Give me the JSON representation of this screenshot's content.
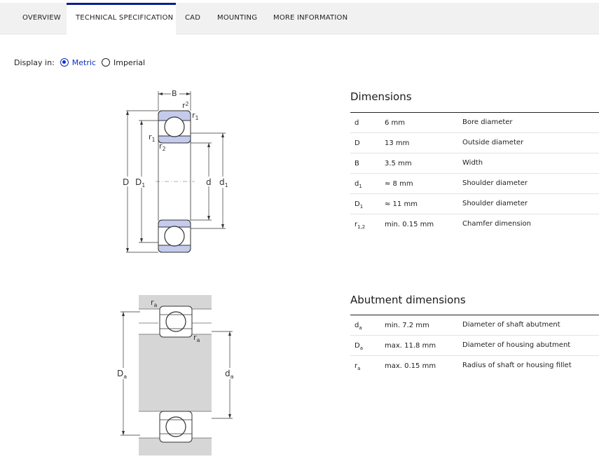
{
  "tabs": [
    {
      "label": "OVERVIEW",
      "active": false
    },
    {
      "label": "TECHNICAL SPECIFICATION",
      "active": true
    },
    {
      "label": "CAD",
      "active": false
    },
    {
      "label": "MOUNTING",
      "active": false
    },
    {
      "label": "MORE INFORMATION",
      "active": false
    }
  ],
  "display": {
    "label": "Display in:",
    "options": [
      {
        "label": "Metric",
        "selected": true
      },
      {
        "label": "Imperial",
        "selected": false
      }
    ]
  },
  "dimensions": {
    "title": "Dimensions",
    "rows": [
      {
        "sym": "d",
        "sub": "",
        "value": "6 mm",
        "desc": "Bore diameter"
      },
      {
        "sym": "D",
        "sub": "",
        "value": "13 mm",
        "desc": "Outside diameter"
      },
      {
        "sym": "B",
        "sub": "",
        "value": "3.5 mm",
        "desc": "Width"
      },
      {
        "sym": "d",
        "sub": "1",
        "value": "≈ 8 mm",
        "desc": "Shoulder diameter"
      },
      {
        "sym": "D",
        "sub": "1",
        "value": "≈ 11 mm",
        "desc": "Shoulder diameter"
      },
      {
        "sym": "r",
        "sub": "1,2",
        "value": "min. 0.15 mm",
        "desc": "Chamfer dimension"
      }
    ]
  },
  "abutment": {
    "title": "Abutment dimensions",
    "rows": [
      {
        "sym": "d",
        "sub": "a",
        "value": "min. 7.2 mm",
        "desc": "Diameter of shaft abutment"
      },
      {
        "sym": "D",
        "sub": "a",
        "value": "max. 11.8 mm",
        "desc": "Diameter of housing abutment"
      },
      {
        "sym": "r",
        "sub": "a",
        "value": "max. 0.15 mm",
        "desc": "Radius of shaft or housing fillet"
      }
    ]
  },
  "diagram1_labels": {
    "B": "B",
    "r2_top": "r",
    "r2_top_sub": "2",
    "r1_top": "r",
    "r1_top_sub": "1",
    "r1_left": "r",
    "r1_left_sub": "1",
    "r2_left": "r",
    "r2_left_sub": "2",
    "D": "D",
    "D1": "D",
    "D1_sub": "1",
    "d": "d",
    "d1": "d",
    "d1_sub": "1"
  },
  "diagram2_labels": {
    "ra_top": "r",
    "ra_top_sub": "a",
    "ra_mid": "r",
    "ra_mid_sub": "a",
    "Da": "D",
    "Da_sub": "a",
    "da": "d",
    "da_sub": "a"
  },
  "colors": {
    "accent": "#0a1e8c",
    "radio": "#1030c0",
    "ring_fill": "#c4cbec",
    "housing_fill": "#d6d6d6"
  }
}
